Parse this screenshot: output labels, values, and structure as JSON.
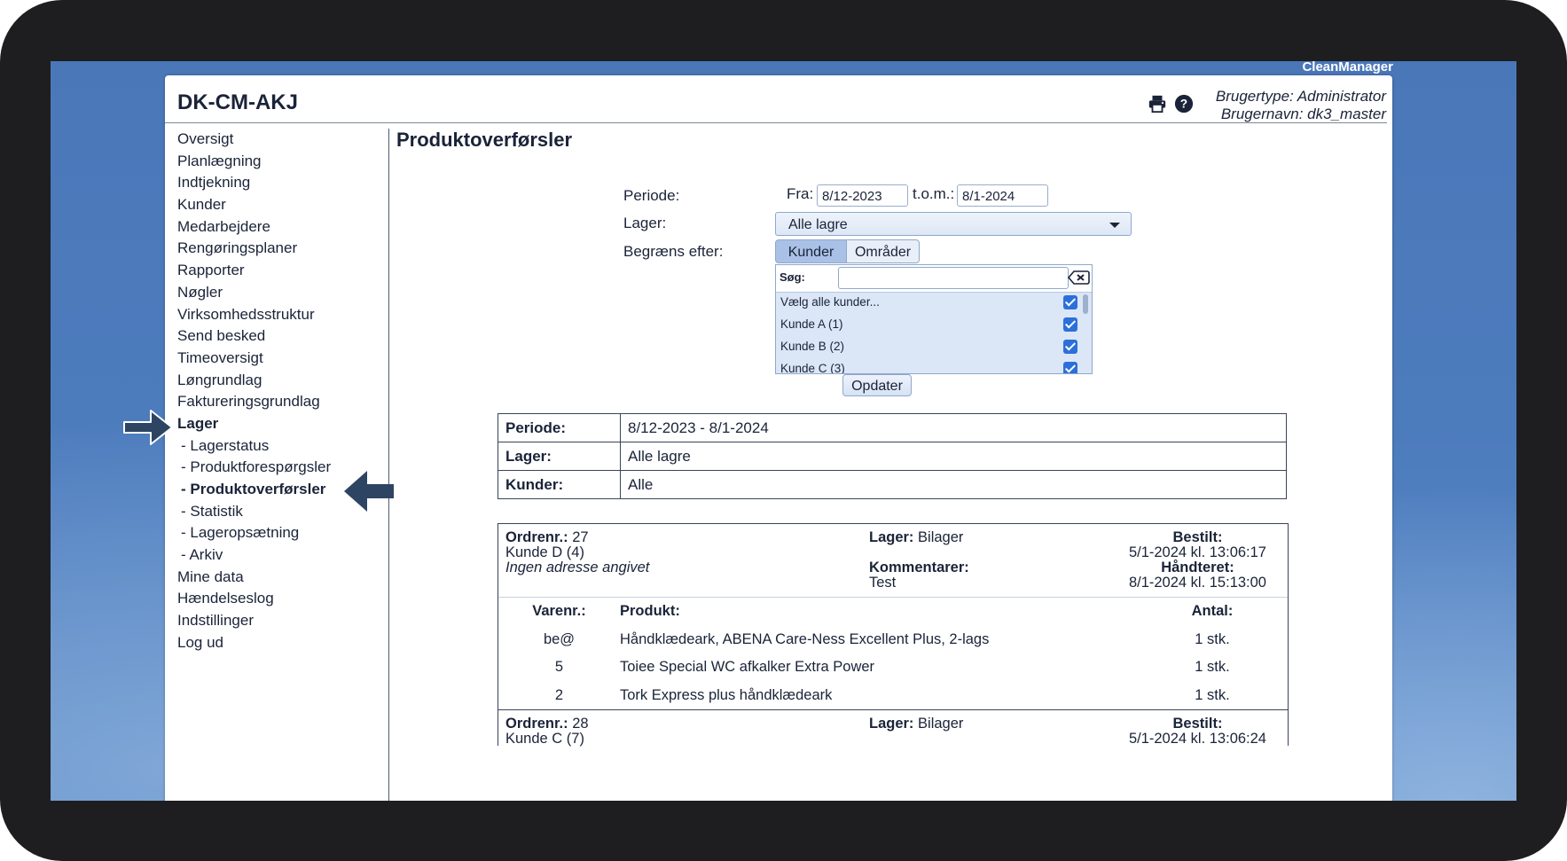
{
  "brand": "CleanManager",
  "header": {
    "title": "DK-CM-AKJ",
    "user_type": "Brugertype: Administrator",
    "user_name": "Brugernavn: dk3_master"
  },
  "sidebar": {
    "items": [
      {
        "label": "Oversigt"
      },
      {
        "label": "Planlægning"
      },
      {
        "label": "Indtjekning"
      },
      {
        "label": "Kunder"
      },
      {
        "label": "Medarbejdere"
      },
      {
        "label": "Rengøringsplaner"
      },
      {
        "label": "Rapporter"
      },
      {
        "label": "Nøgler"
      },
      {
        "label": "Virksomhedsstruktur"
      },
      {
        "label": "Send besked"
      },
      {
        "label": "Timeoversigt"
      },
      {
        "label": "Løngrundlag"
      },
      {
        "label": "Faktureringsgrundlag"
      },
      {
        "label": "Lager"
      },
      {
        "label": "- Lagerstatus"
      },
      {
        "label": "- Produktforespørgsler"
      },
      {
        "label": "- Produktoverførsler"
      },
      {
        "label": "- Statistik"
      },
      {
        "label": "- Lageropsætning"
      },
      {
        "label": "- Arkiv"
      },
      {
        "label": "Mine data"
      },
      {
        "label": "Hændelseslog"
      },
      {
        "label": "Indstillinger"
      },
      {
        "label": "Log ud"
      }
    ]
  },
  "page": {
    "title": "Produktoverførsler"
  },
  "filters": {
    "periode_label": "Periode:",
    "fra_label": "Fra:",
    "fra_value": "8/12-2023",
    "tom_label": "t.o.m.:",
    "tom_value": "8/1-2024",
    "lager_label": "Lager:",
    "lager_value": "Alle lagre",
    "begraens_label": "Begræns efter:",
    "seg_kunder": "Kunder",
    "seg_omraader": "Områder",
    "sog_label": "Søg:",
    "kunder": [
      {
        "label": "Vælg alle kunder..."
      },
      {
        "label": "Kunde A (1)"
      },
      {
        "label": "Kunde B (2)"
      },
      {
        "label": "Kunde C (3)"
      }
    ],
    "update_label": "Opdater"
  },
  "summary": {
    "periode_key": "Periode:",
    "periode_val": "8/12-2023 - 8/1-2024",
    "lager_key": "Lager:",
    "lager_val": "Alle lagre",
    "kunder_key": "Kunder:",
    "kunder_val": "Alle"
  },
  "orders": [
    {
      "ordrenr_label": "Ordrenr.:",
      "ordrenr": "27",
      "kunde": "Kunde D (4)",
      "adresse": "Ingen adresse angivet",
      "lager_label": "Lager:",
      "lager": "Bilager",
      "kommentar_label": "Kommentarer:",
      "kommentar": "Test",
      "bestilt_label": "Bestilt:",
      "bestilt": "5/1-2024 kl. 13:06:17",
      "haandteret_label": "Håndteret:",
      "haandteret": "8/1-2024 kl. 15:13:00",
      "items_header": {
        "varenr": "Varenr.:",
        "produkt": "Produkt:",
        "antal": "Antal:"
      },
      "items": [
        {
          "varenr": "be@",
          "produkt": "Håndklædeark, ABENA Care-Ness Excellent Plus, 2-lags",
          "antal": "1 stk."
        },
        {
          "varenr": "5",
          "produkt": "Toiee Special WC afkalker Extra Power",
          "antal": "1 stk."
        },
        {
          "varenr": "2",
          "produkt": "Tork Express plus håndklædeark",
          "antal": "1 stk."
        }
      ]
    },
    {
      "ordrenr_label": "Ordrenr.:",
      "ordrenr": "28",
      "kunde": "Kunde C (7)",
      "lager_label": "Lager:",
      "lager": "Bilager",
      "bestilt_label": "Bestilt:",
      "bestilt": "5/1-2024 kl. 13:06:24"
    }
  ],
  "icons": [
    "printer-icon",
    "help-icon",
    "clear-search-icon",
    "arrow-right-icon",
    "arrow-left-icon"
  ],
  "colors": {
    "accent": "#2d6fd9",
    "desktop": "#4d7cbd",
    "text": "#1a2338"
  }
}
